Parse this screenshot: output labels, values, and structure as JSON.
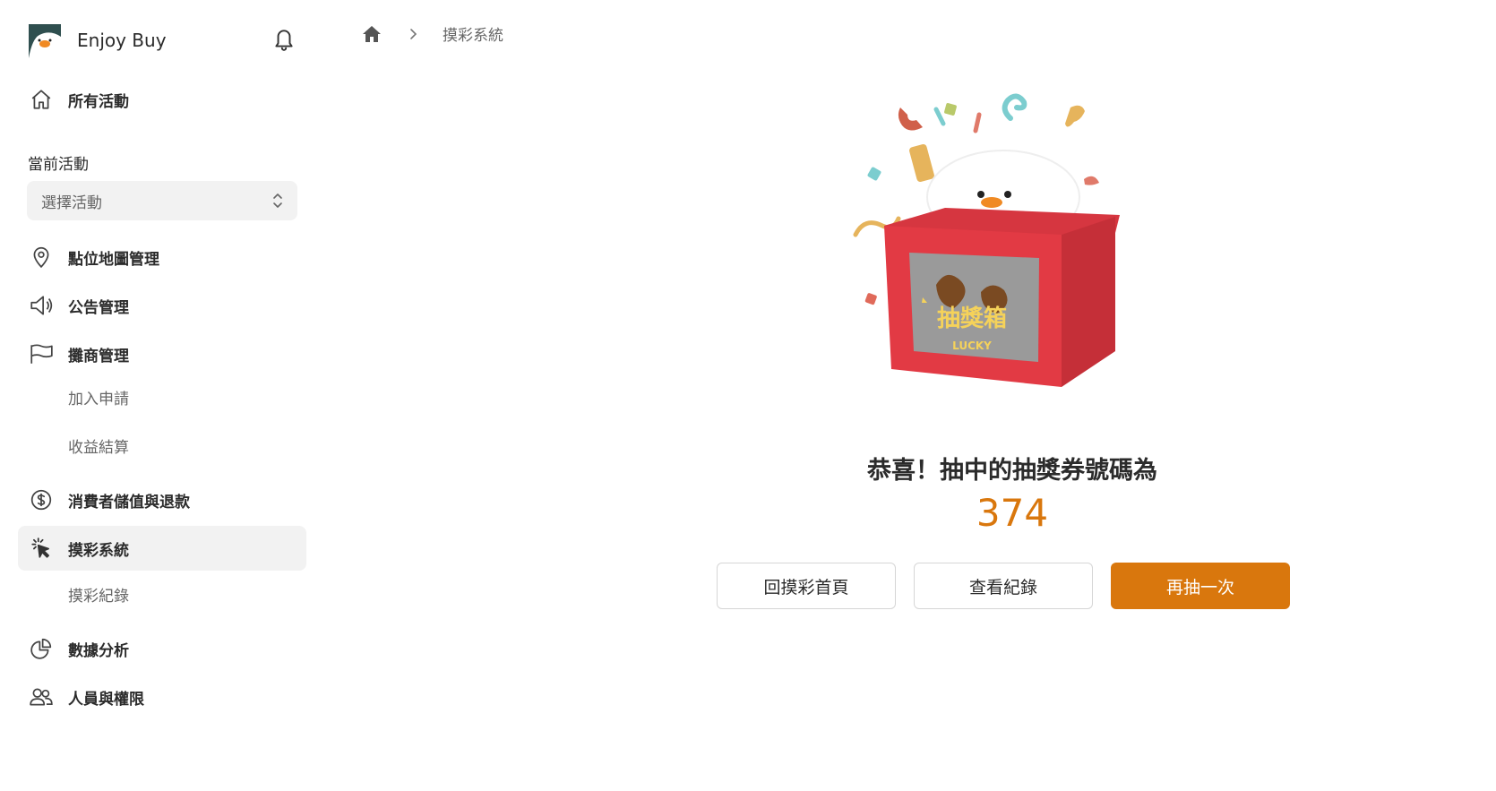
{
  "app": {
    "name": "Enjoy Buy"
  },
  "sidebar": {
    "all_events": "所有活動",
    "current_event_label": "當前活動",
    "select_placeholder": "選擇活動",
    "items": [
      {
        "label": "點位地圖管理",
        "icon": "map-pin-icon"
      },
      {
        "label": "公告管理",
        "icon": "megaphone-icon"
      },
      {
        "label": "攤商管理",
        "icon": "flag-icon"
      },
      {
        "label": "消費者儲值與退款",
        "icon": "dollar-circle-icon"
      },
      {
        "label": "摸彩系統",
        "icon": "click-cursor-icon"
      },
      {
        "label": "數據分析",
        "icon": "pie-chart-icon"
      },
      {
        "label": "人員與權限",
        "icon": "users-icon"
      }
    ],
    "vendor_sub": [
      "加入申請",
      "收益結算"
    ],
    "lottery_sub": [
      "摸彩紀錄"
    ]
  },
  "breadcrumb": {
    "current": "摸彩系統"
  },
  "result": {
    "message": "恭喜！抽中的抽獎券號碼為",
    "number": "374",
    "box_text": "抽獎箱",
    "box_subtext": "LUCKY"
  },
  "buttons": {
    "back_home": "回摸彩首頁",
    "view_records": "查看紀錄",
    "draw_again": "再抽一次"
  },
  "colors": {
    "accent": "#d9770d",
    "active_bg": "#f2f2f2",
    "box_red": "#e23a44"
  }
}
